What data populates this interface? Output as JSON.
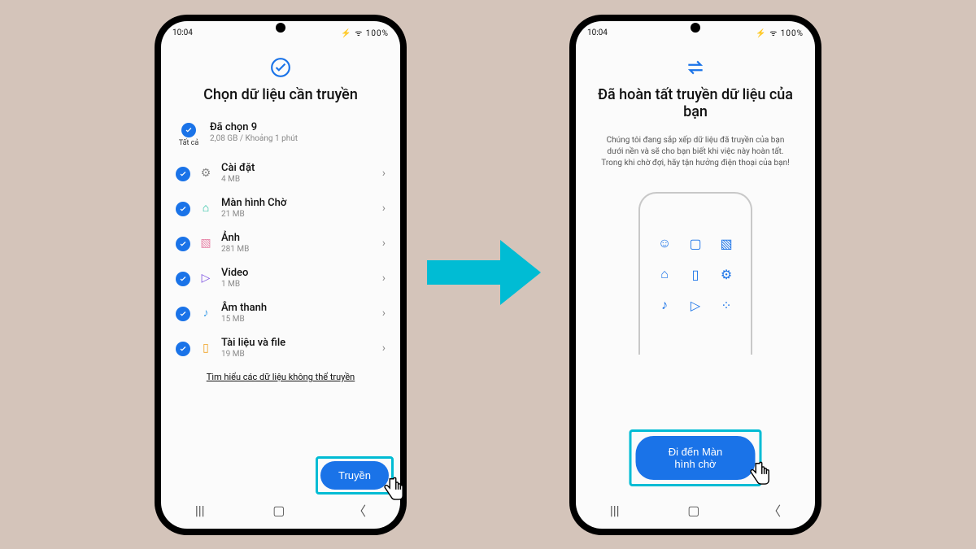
{
  "statusbar": {
    "time": "10:04",
    "right": "⚡ ᯤ 100%"
  },
  "left": {
    "title": "Chọn dữ liệu cần truyền",
    "all_label": "Tất cả",
    "selected_title": "Đã chọn 9",
    "selected_sub": "2,08 GB / Khoảng 1 phút",
    "items": [
      {
        "name": "Cài đặt",
        "size": "4 MB",
        "color": "grey",
        "glyph": "⚙"
      },
      {
        "name": "Màn hình Chờ",
        "size": "21 MB",
        "color": "teal",
        "glyph": "⌂"
      },
      {
        "name": "Ảnh",
        "size": "281 MB",
        "color": "pink",
        "glyph": "▧"
      },
      {
        "name": "Video",
        "size": "1 MB",
        "color": "purple",
        "glyph": "▷"
      },
      {
        "name": "Âm thanh",
        "size": "15 MB",
        "color": "blue",
        "glyph": "♪"
      },
      {
        "name": "Tài liệu và file",
        "size": "19 MB",
        "color": "orange",
        "glyph": "▯"
      }
    ],
    "learn_more": "Tìm hiểu các dữ liệu không thể truyền",
    "cta": "Truyền"
  },
  "right": {
    "title": "Đã hoàn tất truyền dữ liệu của bạn",
    "subtext": "Chúng tôi đang sắp xếp dữ liệu đã truyền của bạn dưới nền và sẽ cho bạn biết khi việc này hoàn tất. Trong khi chờ đợi, hãy tận hưởng điện thoại của bạn!",
    "cta": "Đi đến Màn hình chờ"
  }
}
